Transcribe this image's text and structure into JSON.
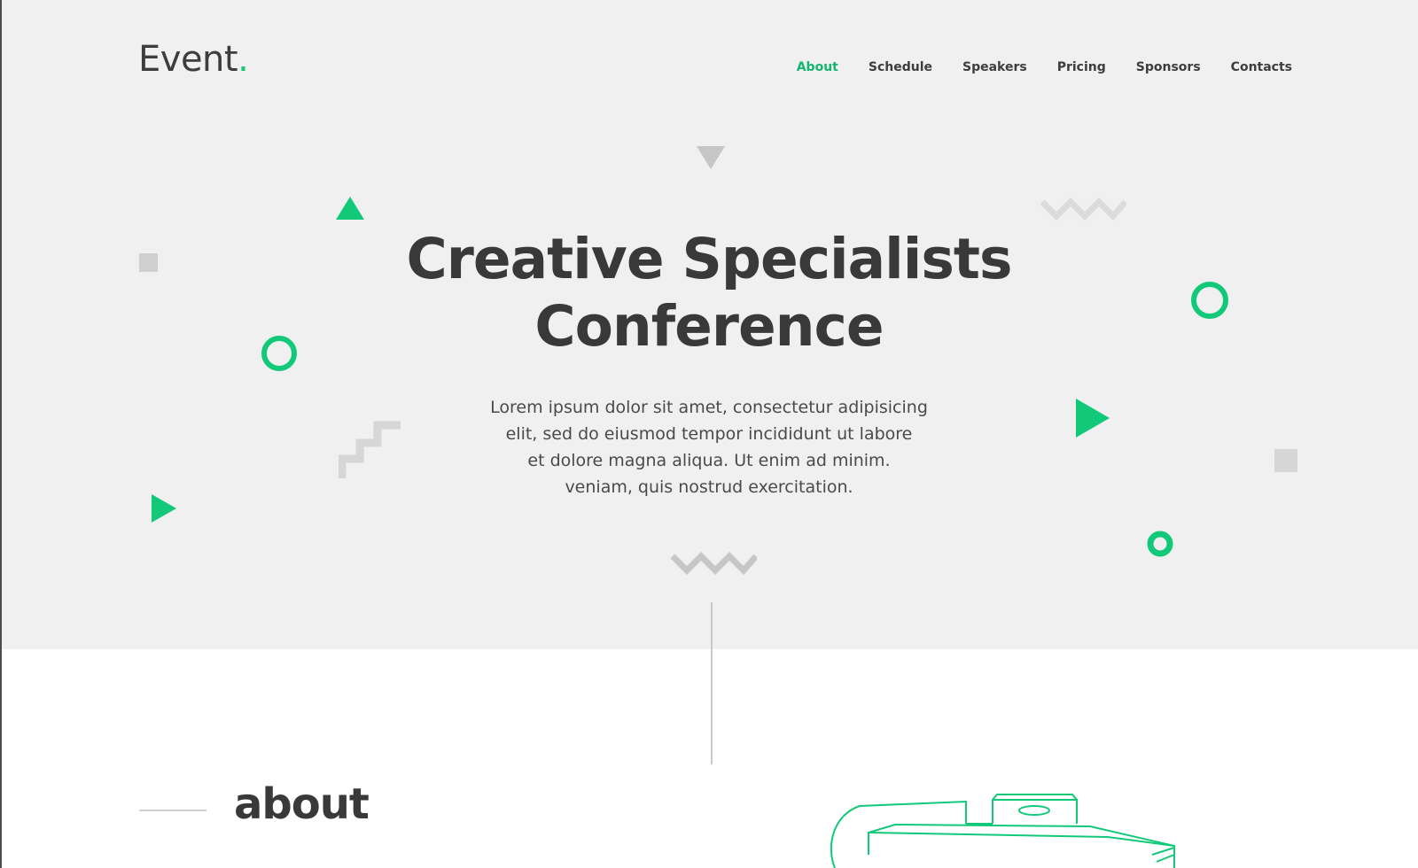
{
  "brand": {
    "name": "Event",
    "dot": ".",
    "accent": "#12c97a"
  },
  "nav": {
    "items": [
      {
        "label": "About",
        "active": true
      },
      {
        "label": "Schedule",
        "active": false
      },
      {
        "label": "Speakers",
        "active": false
      },
      {
        "label": "Pricing",
        "active": false
      },
      {
        "label": "Sponsors",
        "active": false
      },
      {
        "label": "Contacts",
        "active": false
      }
    ]
  },
  "hero": {
    "title_line1": "Creative Specialists",
    "title_line2": "Conference",
    "description_lines": [
      "Lorem ipsum dolor sit amet, consectetur adipisicing",
      "elit, sed do eiusmod tempor incididunt ut labore",
      "et dolore magna aliqua. Ut enim ad minim.",
      "veniam, quis nostrud exercitation."
    ]
  },
  "about": {
    "title": "about"
  },
  "colors": {
    "hero_bg": "#f0f0f0",
    "green": "#12c97a",
    "grey_shape": "#cfcfcf",
    "text": "#3a3a3a"
  }
}
